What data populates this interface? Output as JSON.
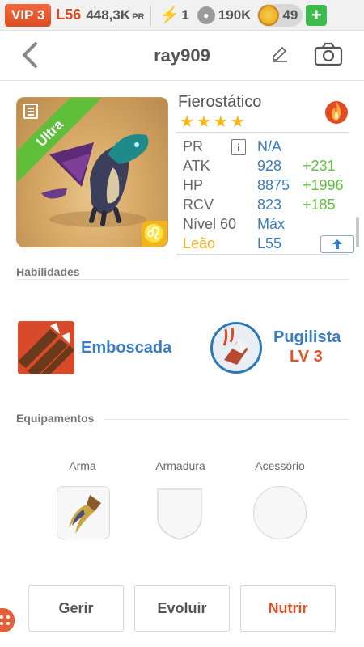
{
  "topbar": {
    "vip": "VIP 3",
    "level": "L56",
    "power": "448,3K",
    "power_unit": "PR",
    "energy": "1",
    "food": "190K",
    "gold": "49",
    "add_symbol": "+"
  },
  "header": {
    "username": "ray909"
  },
  "dragon": {
    "name": "Fierostático",
    "rarity": "Ultra",
    "stars": 4,
    "zodiac_symbol": "♌",
    "element": "fire-icon",
    "stats": {
      "pr_label": "PR",
      "pr_value": "N/A",
      "atk_label": "ATK",
      "atk_value": "928",
      "atk_bonus": "+231",
      "hp_label": "HP",
      "hp_value": "8875",
      "hp_bonus": "+1996",
      "rcv_label": "RCV",
      "rcv_value": "823",
      "rcv_bonus": "+185",
      "level_label": "Nível 60",
      "level_value": "Máx",
      "sign_label": "Leão",
      "sign_value": "L55"
    }
  },
  "skills": {
    "section_title": "Habilidades",
    "items": [
      {
        "name": "Emboscada"
      },
      {
        "name": "Pugilista",
        "level": "LV 3"
      }
    ]
  },
  "equipment": {
    "section_title": "Equipamentos",
    "slots": [
      {
        "label": "Arma"
      },
      {
        "label": "Armadura"
      },
      {
        "label": "Acessório"
      }
    ]
  },
  "actions": {
    "manage": "Gerir",
    "evolve": "Evoluir",
    "nurture": "Nutrir"
  },
  "colors": {
    "accent_blue": "#3a7cc1",
    "bonus_green": "#5fbf3a",
    "alert_orange": "#e0542a",
    "star_gold": "#f4b718"
  }
}
